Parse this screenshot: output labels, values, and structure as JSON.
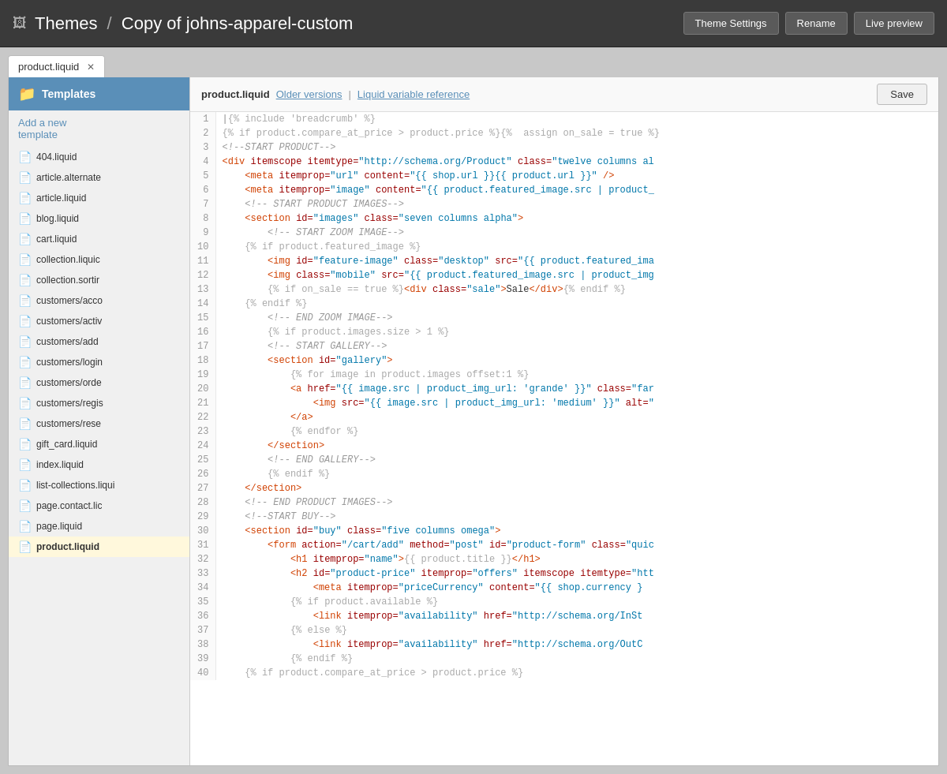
{
  "header": {
    "icon": "🖼",
    "breadcrumb_themes": "Themes",
    "breadcrumb_sep": "/",
    "breadcrumb_current": "Copy of johns-apparel-custom",
    "btn_theme_settings": "Theme Settings",
    "btn_rename": "Rename",
    "btn_live_preview": "Live preview"
  },
  "tabs": [
    {
      "label": "product.liquid",
      "active": true
    }
  ],
  "sidebar": {
    "header": "Templates",
    "add_link": "Add a new template",
    "items": [
      {
        "label": "404.liquid"
      },
      {
        "label": "article.alternate"
      },
      {
        "label": "article.liquid"
      },
      {
        "label": "blog.liquid"
      },
      {
        "label": "cart.liquid"
      },
      {
        "label": "collection.liquic"
      },
      {
        "label": "collection.sortir"
      },
      {
        "label": "customers/acco"
      },
      {
        "label": "customers/activ"
      },
      {
        "label": "customers/add"
      },
      {
        "label": "customers/login"
      },
      {
        "label": "customers/orde"
      },
      {
        "label": "customers/regis"
      },
      {
        "label": "customers/rese"
      },
      {
        "label": "gift_card.liquid"
      },
      {
        "label": "index.liquid"
      },
      {
        "label": "list-collections.liqui"
      },
      {
        "label": "page.contact.lic"
      },
      {
        "label": "page.liquid"
      },
      {
        "label": "product.liquid",
        "active": true
      }
    ]
  },
  "editor": {
    "filename": "product.liquid",
    "link_older": "Older versions",
    "link_liquid": "Liquid variable reference",
    "save_label": "Save"
  },
  "code_lines": [
    "1",
    "2",
    "3",
    "4",
    "5",
    "6",
    "7",
    "8",
    "9",
    "10",
    "11",
    "12",
    "13",
    "14",
    "15",
    "16",
    "17",
    "18",
    "19",
    "20",
    "21",
    "22",
    "23",
    "24",
    "25",
    "26",
    "27",
    "28",
    "29",
    "30",
    "31",
    "32",
    "33",
    "34",
    "35",
    "36",
    "37",
    "38",
    "39",
    "40"
  ]
}
